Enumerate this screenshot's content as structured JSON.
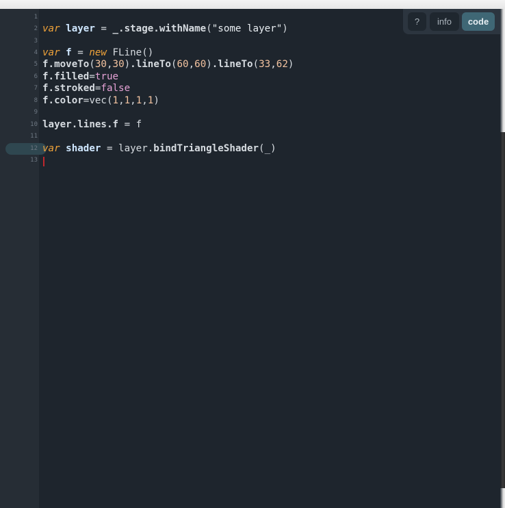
{
  "toolbar": {
    "help_label": "?",
    "info_label": "info",
    "code_label": "code"
  },
  "editor": {
    "line_numbers": [
      "1",
      "2",
      "3",
      "4",
      "5",
      "6",
      "7",
      "8",
      "9",
      "10",
      "11",
      "12",
      "13"
    ],
    "active_line": "12",
    "lines": [
      {
        "n": "1",
        "tokens": []
      },
      {
        "n": "2",
        "tokens": [
          {
            "t": "kw",
            "v": "var "
          },
          {
            "t": "var",
            "v": "layer"
          },
          {
            "t": "plain",
            "v": " = "
          },
          {
            "t": "fn",
            "v": "_.stage.withName"
          },
          {
            "t": "plain",
            "v": "("
          },
          {
            "t": "str",
            "v": "\"some layer\""
          },
          {
            "t": "plain",
            "v": ")"
          }
        ]
      },
      {
        "n": "3",
        "tokens": []
      },
      {
        "n": "4",
        "tokens": [
          {
            "t": "kw",
            "v": "var "
          },
          {
            "t": "var",
            "v": "f"
          },
          {
            "t": "plain",
            "v": " = "
          },
          {
            "t": "kw",
            "v": "new "
          },
          {
            "t": "plain",
            "v": "FLine()"
          }
        ]
      },
      {
        "n": "5",
        "tokens": [
          {
            "t": "fn",
            "v": "f.moveTo"
          },
          {
            "t": "plain",
            "v": "("
          },
          {
            "t": "num",
            "v": "30"
          },
          {
            "t": "plain",
            "v": ","
          },
          {
            "t": "num",
            "v": "30"
          },
          {
            "t": "plain",
            "v": ")"
          },
          {
            "t": "fn",
            "v": ".lineTo"
          },
          {
            "t": "plain",
            "v": "("
          },
          {
            "t": "num",
            "v": "60"
          },
          {
            "t": "plain",
            "v": ","
          },
          {
            "t": "num",
            "v": "60"
          },
          {
            "t": "plain",
            "v": ")"
          },
          {
            "t": "fn",
            "v": ".lineTo"
          },
          {
            "t": "plain",
            "v": "("
          },
          {
            "t": "num",
            "v": "33"
          },
          {
            "t": "plain",
            "v": ","
          },
          {
            "t": "num",
            "v": "62"
          },
          {
            "t": "plain",
            "v": ")"
          }
        ]
      },
      {
        "n": "6",
        "tokens": [
          {
            "t": "fn",
            "v": "f.filled"
          },
          {
            "t": "plain",
            "v": "="
          },
          {
            "t": "bool",
            "v": "true"
          }
        ]
      },
      {
        "n": "7",
        "tokens": [
          {
            "t": "fn",
            "v": "f.stroked"
          },
          {
            "t": "plain",
            "v": "="
          },
          {
            "t": "bool",
            "v": "false"
          }
        ]
      },
      {
        "n": "8",
        "tokens": [
          {
            "t": "fn",
            "v": "f.color"
          },
          {
            "t": "plain",
            "v": "=vec("
          },
          {
            "t": "num",
            "v": "1"
          },
          {
            "t": "plain",
            "v": ","
          },
          {
            "t": "num",
            "v": "1"
          },
          {
            "t": "plain",
            "v": ","
          },
          {
            "t": "num",
            "v": "1"
          },
          {
            "t": "plain",
            "v": ","
          },
          {
            "t": "num",
            "v": "1"
          },
          {
            "t": "plain",
            "v": ")"
          }
        ]
      },
      {
        "n": "9",
        "tokens": []
      },
      {
        "n": "10",
        "tokens": [
          {
            "t": "fn",
            "v": "layer.lines.f"
          },
          {
            "t": "plain",
            "v": " = f"
          }
        ]
      },
      {
        "n": "11",
        "tokens": []
      },
      {
        "n": "12",
        "tokens": [
          {
            "t": "kw",
            "v": "var "
          },
          {
            "t": "var",
            "v": "shader"
          },
          {
            "t": "plain",
            "v": " = "
          },
          {
            "t": "plain",
            "v": "layer."
          },
          {
            "t": "fn",
            "v": "bindTriangleShader"
          },
          {
            "t": "plain",
            "v": "(_)"
          }
        ]
      },
      {
        "n": "13",
        "tokens": []
      }
    ]
  },
  "colors": {
    "background": "#1e252d",
    "gutter": "#262d35",
    "keyword": "#f0a33a",
    "variable": "#cfe7ff",
    "number": "#f3c3a0",
    "boolean": "#e6a3d6",
    "active_button": "#3f6775",
    "cursor": "#c0272d"
  }
}
